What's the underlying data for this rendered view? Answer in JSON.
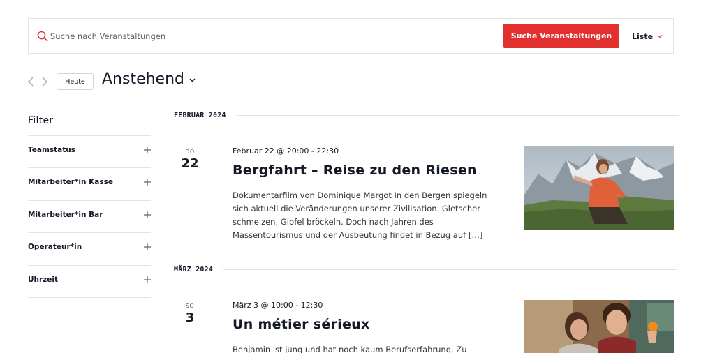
{
  "search": {
    "placeholder": "Suche nach Veranstaltungen",
    "value": "",
    "button_label": "Suche Veranstaltungen",
    "view_label": "Liste"
  },
  "nav": {
    "today_label": "Heute",
    "period_label": "Anstehend"
  },
  "filter": {
    "heading": "Filter",
    "groups": [
      {
        "label": "Teamstatus"
      },
      {
        "label": "Mitarbeiter*in Kasse"
      },
      {
        "label": "Mitarbeiter*in Bar"
      },
      {
        "label": "Operateur*in"
      },
      {
        "label": "Uhrzeit"
      }
    ]
  },
  "months": [
    {
      "label": "FEBRUAR 2024",
      "events": [
        {
          "weekday": "DO",
          "day": "22",
          "datetime": "Februar 22 @ 20:00 - 22:30",
          "title": "Bergfahrt – Reise zu den Riesen",
          "description": "Dokumentarfilm von Dominique Margot In den Bergen spiegeln sich aktuell die Veränderungen unserer Zivilisation. Gletscher schmelzen, Gipfel bröckeln. Doch nach Jahren des Massentourismus und der Ausbeutung findet in Bezug auf […]"
        }
      ]
    },
    {
      "label": "MÄRZ 2024",
      "events": [
        {
          "weekday": "SO",
          "day": "3",
          "datetime": "März 3 @ 10:00 - 12:30",
          "title": "Un métier sérieux",
          "description": "Benjamin ist jung und hat noch kaum Berufserfahrung. Zu"
        }
      ]
    }
  ],
  "colors": {
    "accent": "#e1302e",
    "text": "#141827",
    "border": "#e4e4e4"
  },
  "icons": [
    "search-icon",
    "chevron-down-icon",
    "chevron-left-icon",
    "chevron-right-icon",
    "plus-icon"
  ]
}
